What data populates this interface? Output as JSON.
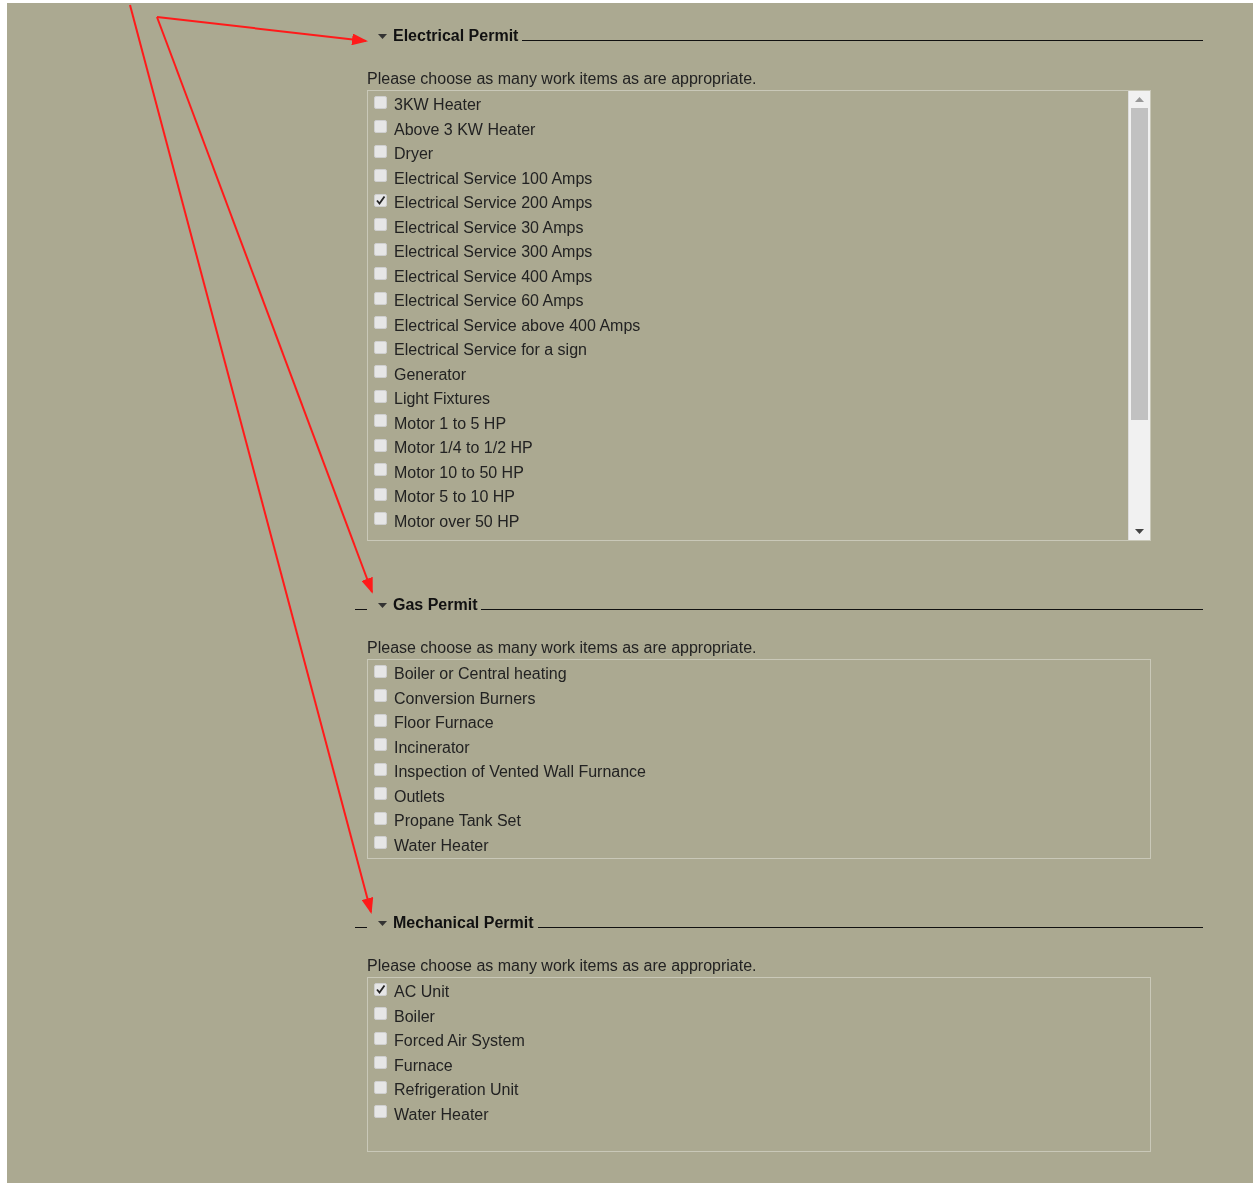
{
  "sections": [
    {
      "title": "Electrical Permit",
      "expanded": true,
      "left_dash": false,
      "scrollable": true,
      "instructions": "Please choose as many work items as are appropriate.",
      "items": [
        {
          "label": "3KW Heater",
          "checked": false
        },
        {
          "label": "Above 3 KW Heater",
          "checked": false
        },
        {
          "label": "Dryer",
          "checked": false
        },
        {
          "label": "Electrical Service 100 Amps",
          "checked": false
        },
        {
          "label": "Electrical Service 200 Amps",
          "checked": true
        },
        {
          "label": "Electrical Service 30 Amps",
          "checked": false
        },
        {
          "label": "Electrical Service 300 Amps",
          "checked": false
        },
        {
          "label": "Electrical Service 400 Amps",
          "checked": false
        },
        {
          "label": "Electrical Service 60 Amps",
          "checked": false
        },
        {
          "label": "Electrical Service above 400 Amps",
          "checked": false
        },
        {
          "label": "Electrical Service for a sign",
          "checked": false
        },
        {
          "label": "Generator",
          "checked": false
        },
        {
          "label": "Light Fixtures",
          "checked": false
        },
        {
          "label": "Motor 1 to 5 HP",
          "checked": false
        },
        {
          "label": "Motor 1/4 to 1/2 HP",
          "checked": false
        },
        {
          "label": "Motor 10 to 50 HP",
          "checked": false
        },
        {
          "label": "Motor 5 to 10 HP",
          "checked": false
        },
        {
          "label": "Motor over 50 HP",
          "checked": false
        }
      ]
    },
    {
      "title": "Gas Permit",
      "expanded": true,
      "left_dash": true,
      "scrollable": false,
      "instructions": "Please choose as many work items as are appropriate.",
      "items": [
        {
          "label": "Boiler or Central heating",
          "checked": false
        },
        {
          "label": "Conversion Burners",
          "checked": false
        },
        {
          "label": "Floor Furnace",
          "checked": false
        },
        {
          "label": "Incinerator",
          "checked": false
        },
        {
          "label": "Inspection of Vented Wall Furnance",
          "checked": false
        },
        {
          "label": "Outlets",
          "checked": false
        },
        {
          "label": "Propane Tank Set",
          "checked": false
        },
        {
          "label": "Water Heater",
          "checked": false
        }
      ]
    },
    {
      "title": "Mechanical Permit",
      "expanded": true,
      "left_dash": true,
      "scrollable": false,
      "instructions": "Please choose as many work items as are appropriate.",
      "items": [
        {
          "label": "AC Unit",
          "checked": true
        },
        {
          "label": "Boiler",
          "checked": false
        },
        {
          "label": "Forced Air System",
          "checked": false
        },
        {
          "label": "Furnace",
          "checked": false
        },
        {
          "label": "Refrigeration Unit",
          "checked": false
        },
        {
          "label": "Water Heater",
          "checked": false
        }
      ]
    }
  ]
}
